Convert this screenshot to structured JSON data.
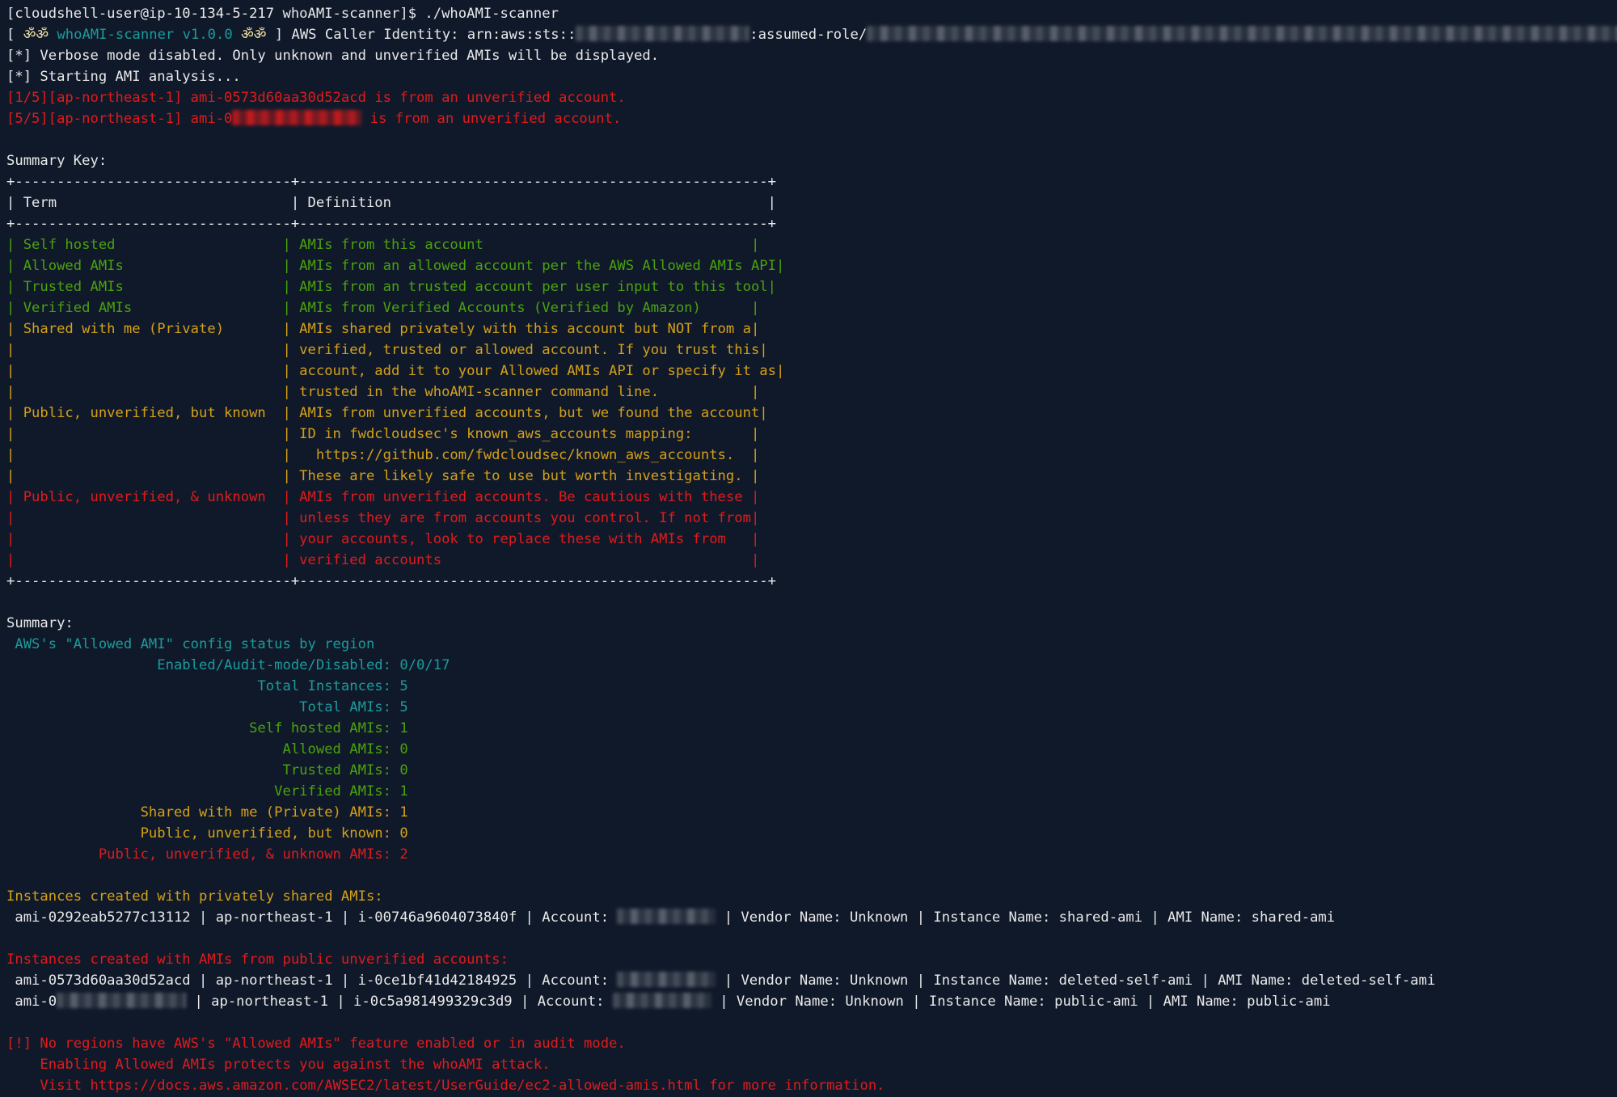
{
  "terminal": {
    "background_color": "#10192a",
    "colors": {
      "white": "#e9e9e9",
      "green": "#4aa20c",
      "yellow": "#d4a017",
      "red": "#e01b1b",
      "cyan": "#1a9b9b"
    },
    "prompt": {
      "text": "[cloudshell-user@ip-10-134-5-217 whoAMI-scanner]$ ",
      "command": "./whoAMI-scanner"
    },
    "banner": {
      "bracket_open": "[ ",
      "eyes_left": "ॐॐ",
      "tool_name": " whoAMI-scanner v1.0.0 ",
      "eyes_right": "ॐॐ",
      "bracket_close": " ] ",
      "caller_identity_prefix": "AWS Caller Identity: arn:aws:sts::",
      "caller_identity_middle": ":assumed-role/"
    },
    "status_lines": [
      "[*] Verbose mode disabled. Only unknown and unverified AMIs will be displayed.",
      "[*] Starting AMI analysis..."
    ],
    "unverified_findings": [
      {
        "prefix": "[1/5][ap-northeast-1] ami-0573d60aa30d52acd",
        "suffix": " is from an unverified account.",
        "redacted": false
      },
      {
        "prefix": "[5/5][ap-northeast-1] ami-0",
        "suffix": " is from an unverified account.",
        "redacted": true
      }
    ],
    "summary_key": {
      "heading": "Summary Key:",
      "rule": "+---------------------------------+--------------------------------------------------------+",
      "header_term": "| Term                            ",
      "header_definition": "| Definition                                             ",
      "header_end": "|",
      "rows": [
        {
          "color": "green",
          "term": "Self hosted",
          "definition_lines": [
            "AMIs from this account"
          ]
        },
        {
          "color": "green",
          "term": "Allowed AMIs",
          "definition_lines": [
            "AMIs from an allowed account per the AWS Allowed AMIs API"
          ]
        },
        {
          "color": "green",
          "term": "Trusted AMIs",
          "definition_lines": [
            "AMIs from an trusted account per user input to this tool"
          ]
        },
        {
          "color": "green",
          "term": "Verified AMIs",
          "definition_lines": [
            "AMIs from Verified Accounts (Verified by Amazon)"
          ]
        },
        {
          "color": "yellow",
          "term": "Shared with me (Private)",
          "definition_lines": [
            "AMIs shared privately with this account but NOT from a",
            "verified, trusted or allowed account. If you trust this",
            "account, add it to your Allowed AMIs API or specify it as",
            "trusted in the whoAMI-scanner command line."
          ]
        },
        {
          "color": "yellow",
          "term": "Public, unverified, but known",
          "definition_lines": [
            "AMIs from unverified accounts, but we found the account",
            "ID in fwdcloudsec's known_aws_accounts mapping:",
            "  https://github.com/fwdcloudsec/known_aws_accounts.",
            "These are likely safe to use but worth investigating."
          ]
        },
        {
          "color": "red",
          "term": "Public, unverified, & unknown",
          "definition_lines": [
            "AMIs from unverified accounts. Be cautious with these",
            "unless they are from accounts you control. If not from",
            "your accounts, look to replace these with AMIs from",
            "verified accounts"
          ]
        }
      ]
    },
    "summary": {
      "heading": "Summary:",
      "config_status_title": "AWS's \"Allowed AMI\" config status by region",
      "stats": [
        {
          "color": "cyan",
          "label": "Enabled/Audit-mode/Disabled:",
          "value": "0/0/17"
        },
        {
          "color": "cyan",
          "label": "Total Instances:",
          "value": "5"
        },
        {
          "color": "cyan",
          "label": "Total AMIs:",
          "value": "5"
        },
        {
          "color": "green",
          "label": "Self hosted AMIs:",
          "value": "1"
        },
        {
          "color": "green",
          "label": "Allowed AMIs:",
          "value": "0"
        },
        {
          "color": "green",
          "label": "Trusted AMIs:",
          "value": "0"
        },
        {
          "color": "green",
          "label": "Verified AMIs:",
          "value": "1"
        },
        {
          "color": "yellow",
          "label": "Shared with me (Private) AMIs:",
          "value": "1"
        },
        {
          "color": "yellow",
          "label": "Public, unverified, but known:",
          "value": "0"
        },
        {
          "color": "red",
          "label": "Public, unverified, & unknown AMIs:",
          "value": "2"
        }
      ]
    },
    "private_shared_section": {
      "heading": "Instances created with privately shared AMIs:",
      "rows": [
        {
          "ami_id": "ami-0292eab5277c13112",
          "region": "ap-northeast-1",
          "instance_id": "i-00746a9604073840f",
          "account_label": "Account:",
          "account_redacted": true,
          "vendor_name": "Vendor Name: Unknown",
          "instance_name": "Instance Name: shared-ami",
          "ami_name": "AMI Name: shared-ami"
        }
      ]
    },
    "public_unverified_section": {
      "heading": "Instances created with AMIs from public unverified accounts:",
      "rows": [
        {
          "ami_id": "ami-0573d60aa30d52acd",
          "ami_id_redacted": false,
          "region": "ap-northeast-1",
          "instance_id": "i-0ce1bf41d42184925",
          "account_label": "Account:",
          "account_redacted": true,
          "vendor_name": "Vendor Name: Unknown",
          "instance_name": "Instance Name: deleted-self-ami",
          "ami_name": "AMI Name: deleted-self-ami"
        },
        {
          "ami_id": "ami-0",
          "ami_id_redacted": true,
          "region": "ap-northeast-1",
          "instance_id": "i-0c5a981499329c3d9",
          "account_label": "Account:",
          "account_redacted": true,
          "vendor_name": "Vendor Name: Unknown",
          "instance_name": "Instance Name: public-ami",
          "ami_name": "AMI Name: public-ami"
        }
      ]
    },
    "footer_warning": [
      "[!] No regions have AWS's \"Allowed AMIs\" feature enabled or in audit mode.",
      "    Enabling Allowed AMIs protects you against the whoAMI attack.",
      "    Visit https://docs.aws.amazon.com/AWSEC2/latest/UserGuide/ec2-allowed-amis.html for more information."
    ]
  }
}
